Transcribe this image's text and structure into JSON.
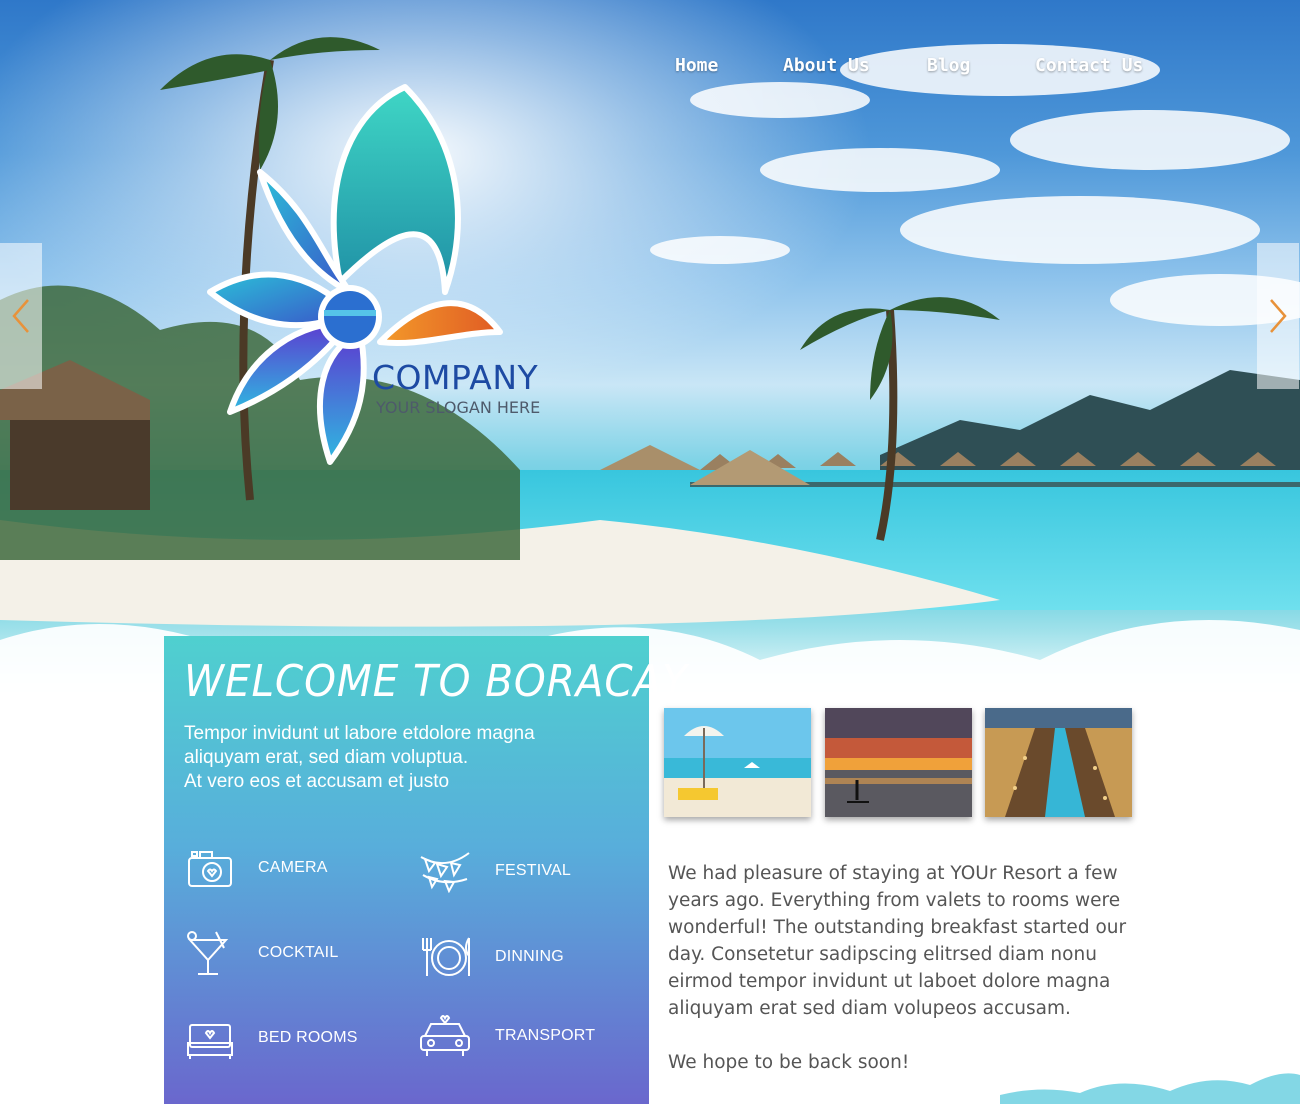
{
  "nav": {
    "items": [
      {
        "label": "Home"
      },
      {
        "label": "About Us"
      },
      {
        "label": "Blog"
      },
      {
        "label": "Contact Us"
      }
    ]
  },
  "slider": {
    "prev_icon": "chevron-left-icon",
    "next_icon": "chevron-right-icon",
    "accent_color": "#e8923a"
  },
  "logo": {
    "company": "COMPANY",
    "slogan": "YOUR SLOGAN HERE"
  },
  "welcome": {
    "title": "WELCOME TO BORACAY",
    "intro_lines": [
      "Tempor invidunt ut labore etdolore magna",
      "aliquyam erat, sed diam voluptua.",
      "At vero eos et accusam et justo"
    ],
    "amenities": [
      {
        "label": "CAMERA",
        "icon": "camera-icon"
      },
      {
        "label": "FESTIVAL",
        "icon": "bunting-icon"
      },
      {
        "label": "COCKTAIL",
        "icon": "cocktail-icon"
      },
      {
        "label": "DINNING",
        "icon": "dining-icon"
      },
      {
        "label": "BED ROOMS",
        "icon": "bed-icon"
      },
      {
        "label": "TRANSPORT",
        "icon": "car-icon"
      }
    ]
  },
  "gallery": [
    {
      "name": "beach-umbrella-photo"
    },
    {
      "name": "sunset-paddleboard-photo"
    },
    {
      "name": "resort-pool-photo"
    }
  ],
  "review": {
    "lines": [
      "We had pleasure of staying at YOUr Resort a few",
      "years ago. Everything from valets to rooms were",
      "wonderful! The outstanding breakfast started our",
      "day. Consetetur sadipscing elitrsed diam nonu",
      "eirmod tempor invidunt ut laboet dolore magna",
      "aliquyam erat sed diam volupeos accusam."
    ],
    "closing": "We hope to be back soon!"
  },
  "colors": {
    "panel_top": "#4fd0cf",
    "panel_bottom": "#6a67cd",
    "brand_blue": "#1d4aa3",
    "text_gray": "#555555"
  }
}
